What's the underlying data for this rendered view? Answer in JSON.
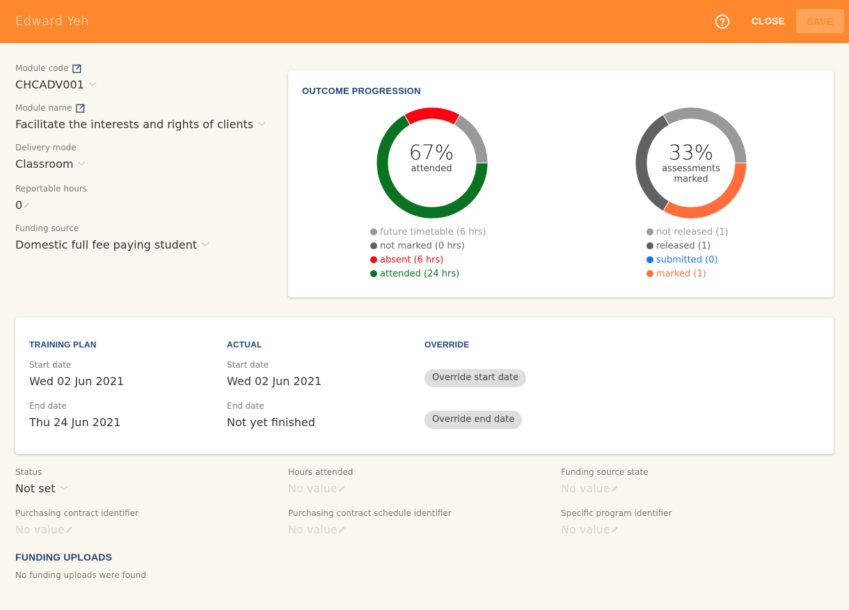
{
  "header": {
    "title": "Edward Yeh",
    "close_label": "CLOSE",
    "save_label": "SAVE",
    "accent_color": "#fd882e"
  },
  "module": {
    "code": {
      "label": "Module code",
      "value": "CHCADV001"
    },
    "name": {
      "label": "Module name",
      "value": "Facilitate the interests and rights of clients"
    },
    "delivery_mode": {
      "label": "Delivery mode",
      "value": "Classroom"
    },
    "reportable_hours": {
      "label": "Reportable hours",
      "value": "0"
    },
    "funding_source": {
      "label": "Funding source",
      "value": "Domestic full fee paying student"
    }
  },
  "outcome": {
    "title": "OUTCOME PROGRESSION",
    "attendance": {
      "percent_label": "67%",
      "sub_label": "attended",
      "legend": [
        {
          "label": "future timetable (6 hrs)",
          "color": "#999999"
        },
        {
          "label": "not marked (0 hrs)",
          "color": "#616161"
        },
        {
          "label": "absent (6 hrs)",
          "color": "#ff0012"
        },
        {
          "label": "attended (24 hrs)",
          "color": "#0a7321"
        }
      ]
    },
    "assessments": {
      "percent_label": "33%",
      "sub_label_1": "assessments",
      "sub_label_2": "marked",
      "legend": [
        {
          "label": "not released (1)",
          "color": "#999999"
        },
        {
          "label": "released (1)",
          "color": "#616161"
        },
        {
          "label": "submitted (0)",
          "color": "#1a73e8"
        },
        {
          "label": "marked (1)",
          "color": "#ff6e3c"
        }
      ]
    }
  },
  "chart_data": [
    {
      "type": "pie",
      "title": "attended",
      "center_label": "67%",
      "categories": [
        "attended",
        "absent",
        "not marked",
        "future timetable"
      ],
      "values": [
        24,
        6,
        0,
        6
      ],
      "units": "hrs",
      "colors": [
        "#0a7321",
        "#ff0012",
        "#616161",
        "#999999"
      ]
    },
    {
      "type": "pie",
      "title": "assessments marked",
      "center_label": "33%",
      "categories": [
        "marked",
        "submitted",
        "released",
        "not released"
      ],
      "values": [
        1,
        0,
        1,
        1
      ],
      "colors": [
        "#ff6e3c",
        "#1a73e8",
        "#616161",
        "#999999"
      ]
    }
  ],
  "dates": {
    "training_plan": {
      "title": "TRAINING PLAN",
      "start_label": "Start date",
      "start_value": "Wed 02 Jun 2021",
      "end_label": "End date",
      "end_value": "Thu 24 Jun 2021"
    },
    "actual": {
      "title": "ACTUAL",
      "start_label": "Start date",
      "start_value": "Wed 02 Jun 2021",
      "end_label": "End date",
      "end_value": "Not yet finished"
    },
    "override": {
      "title": "OVERRIDE",
      "start_button": "Override start date",
      "end_button": "Override end date"
    }
  },
  "details": {
    "status": {
      "label": "Status",
      "value": "Not set"
    },
    "hours_attended": {
      "label": "Hours attended",
      "value": "No value"
    },
    "funding_source_state": {
      "label": "Funding source state",
      "value": "No value"
    },
    "purchasing_contract_id": {
      "label": "Purchasing contract identifier",
      "value": "No value"
    },
    "purchasing_contract_schedule_id": {
      "label": "Purchasing contract schedule identifier",
      "value": "No value"
    },
    "specific_program_id": {
      "label": "Specific program identifier",
      "value": "No value"
    }
  },
  "funding_uploads": {
    "title": "FUNDING UPLOADS",
    "empty_message": "No funding uploads were found"
  }
}
